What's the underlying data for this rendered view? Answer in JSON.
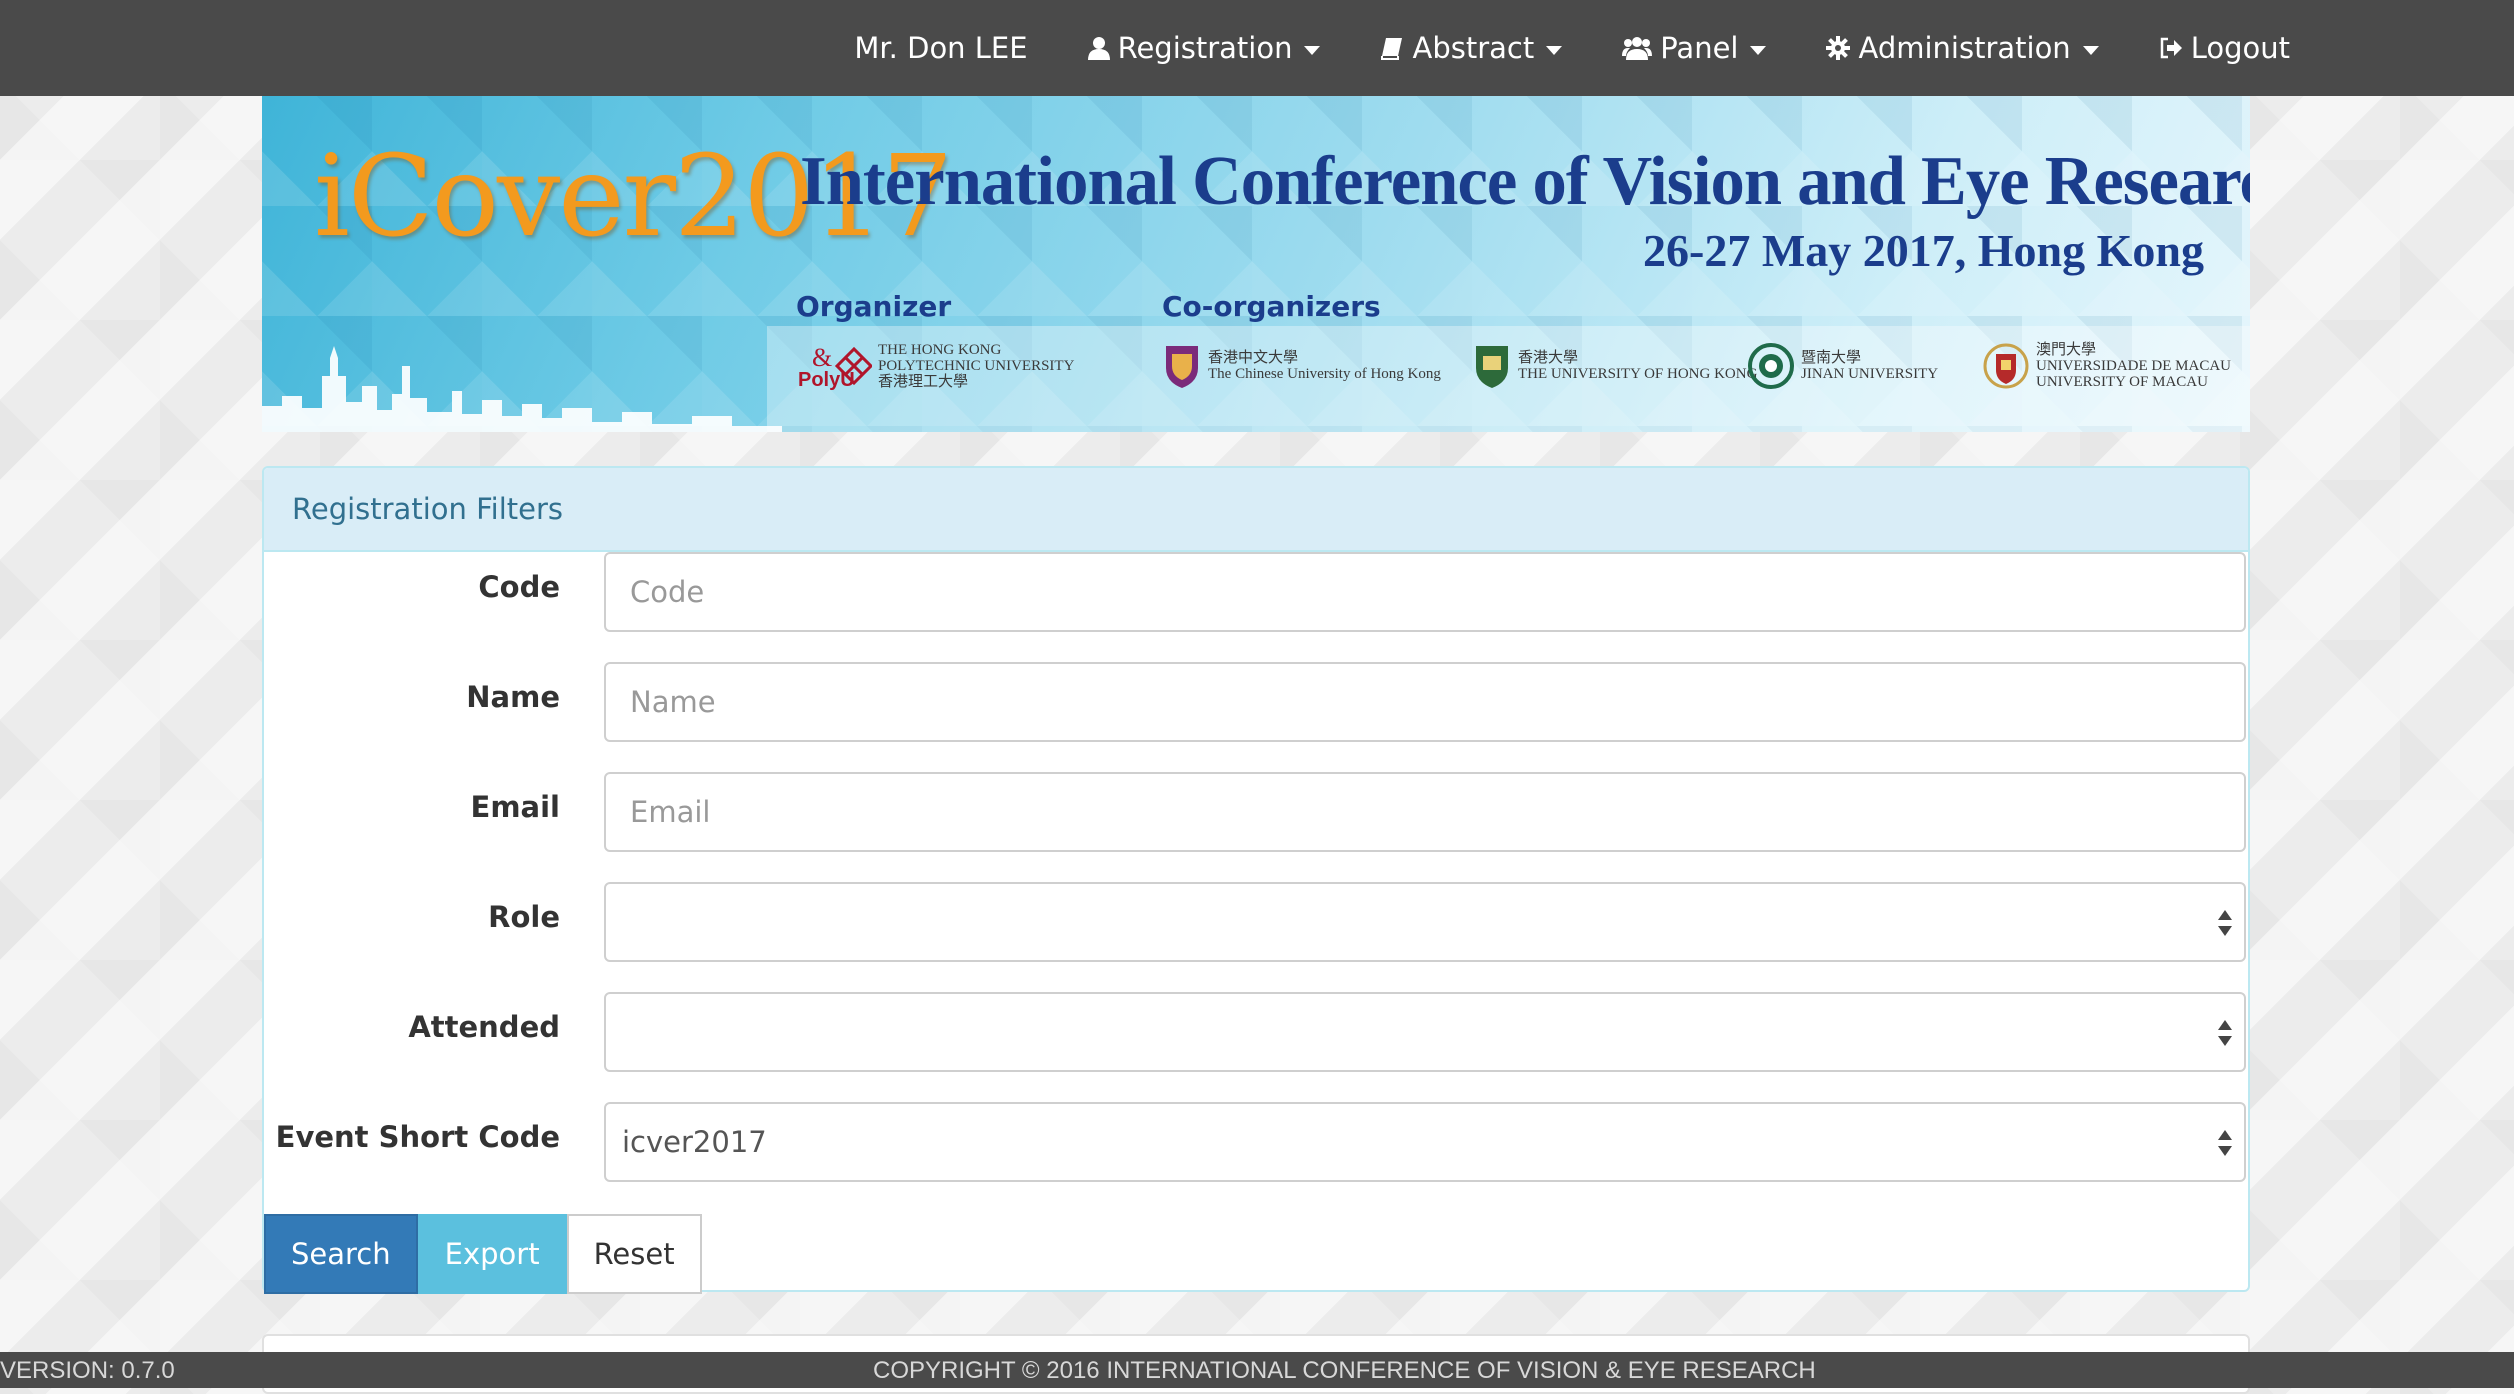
{
  "navbar": {
    "user": "Mr. Don LEE",
    "items": [
      {
        "label": "Registration",
        "icon": "user-icon"
      },
      {
        "label": "Abstract",
        "icon": "book-icon"
      },
      {
        "label": "Panel",
        "icon": "users-icon"
      },
      {
        "label": "Administration",
        "icon": "gear-icon"
      }
    ],
    "logout": "Logout"
  },
  "banner": {
    "logo": "iCover2017",
    "title": "International Conference of Vision and Eye Research",
    "date": "26-27 May 2017, Hong Kong",
    "organizer_label": "Organizer",
    "coorganizers_label": "Co-organizers",
    "sponsors": [
      {
        "line1": "PolyU",
        "line2": "THE HONG KONG",
        "line3": "POLYTECHNIC UNIVERSITY",
        "line4": "香港理工大學"
      },
      {
        "line1": "香港中文大學",
        "line2": "The Chinese University of Hong Kong"
      },
      {
        "line1": "香港大學",
        "line2": "THE UNIVERSITY OF HONG KONG"
      },
      {
        "line1": "暨南大學",
        "line2": "JINAN UNIVERSITY"
      },
      {
        "line1": "澳門大學",
        "line2": "UNIVERSIDADE DE MACAU",
        "line3": "UNIVERSITY OF MACAU"
      }
    ]
  },
  "filters": {
    "heading": "Registration Filters",
    "code": {
      "label": "Code",
      "placeholder": "Code"
    },
    "name": {
      "label": "Name",
      "placeholder": "Name"
    },
    "email": {
      "label": "Email",
      "placeholder": "Email"
    },
    "role": {
      "label": "Role",
      "value": ""
    },
    "attended": {
      "label": "Attended",
      "value": ""
    },
    "event_short_code": {
      "label": "Event Short Code",
      "value": "icver2017"
    },
    "buttons": {
      "search": "Search",
      "export": "Export",
      "reset": "Reset"
    }
  },
  "footer": {
    "version": "VERSION: 0.7.0",
    "copyright": "COPYRIGHT © 2016 INTERNATIONAL CONFERENCE OF VISION & EYE RESEARCH"
  },
  "colors": {
    "navbar": "#4a4a4a",
    "panel_heading": "#d9edf7",
    "search_button": "#337ab7",
    "export_button": "#5bc0de",
    "banner_title": "#1b3d8c",
    "logo": "#f39a1e"
  }
}
